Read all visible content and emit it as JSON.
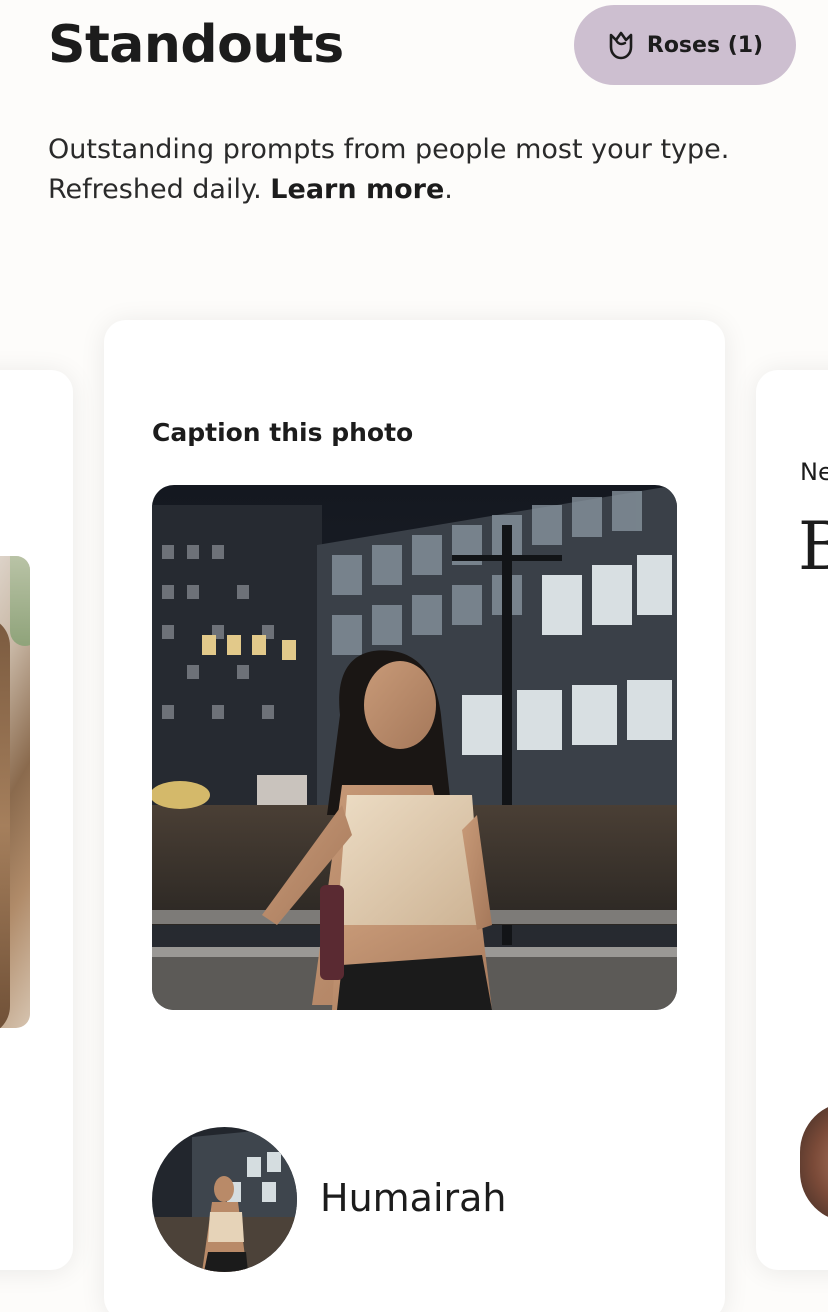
{
  "header": {
    "title": "Standouts",
    "roses_button_label": "Roses (1)",
    "roses_icon": "rose-icon"
  },
  "description": {
    "text": "Outstanding prompts from people most your type. Refreshed daily.",
    "link_label": "Learn more",
    "suffix": "."
  },
  "main_card": {
    "prompt_title": "Caption this photo",
    "profile_name": "Humairah"
  },
  "next_card": {
    "label_fragment": "Ne",
    "big_text_fragment": "B"
  },
  "colors": {
    "background": "#fdfcfa",
    "roses_button": "#cdbfd0",
    "card": "#ffffff",
    "text": "#1c1c1c"
  }
}
